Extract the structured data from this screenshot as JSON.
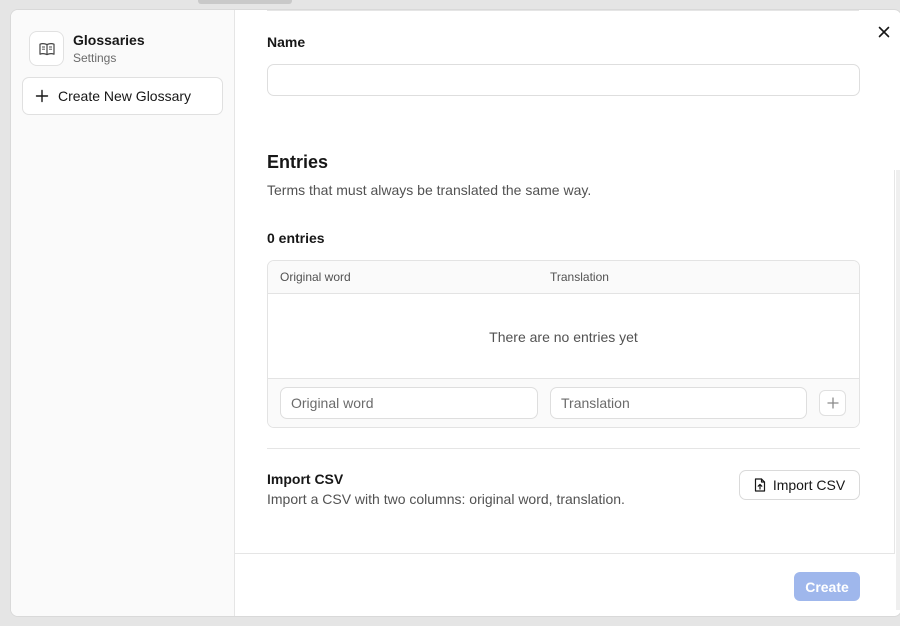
{
  "sidebar": {
    "title": "Glossaries",
    "subtitle": "Settings",
    "create_label": "Create New Glossary"
  },
  "form": {
    "name_label": "Name",
    "name_value": "",
    "name_placeholder": ""
  },
  "entries": {
    "title": "Entries",
    "description": "Terms that must always be translated the same way.",
    "count_label": "0 entries",
    "columns": [
      "Original word",
      "Translation"
    ],
    "empty_message": "There are no entries yet",
    "original_placeholder": "Original word",
    "translation_placeholder": "Translation"
  },
  "import": {
    "title": "Import CSV",
    "description": "Import a CSV with two columns: original word, translation.",
    "button_label": "Import CSV"
  },
  "footer": {
    "create_label": "Create"
  },
  "colors": {
    "primary_disabled": "#9fb7ec"
  },
  "icons": {
    "brand": "book-open-icon",
    "create": "plus-icon",
    "close": "close-icon",
    "add_row": "plus-icon",
    "import": "file-upload-icon"
  }
}
